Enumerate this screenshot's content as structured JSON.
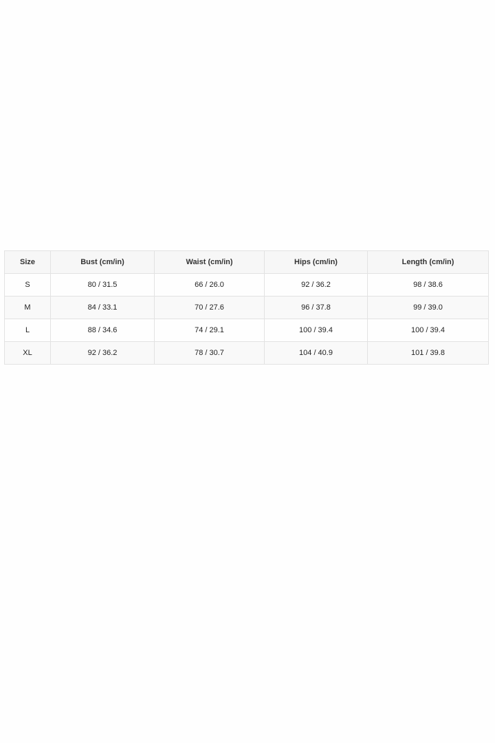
{
  "size_chart": {
    "headers": [
      "Size",
      "Bust (cm/in)",
      "Waist (cm/in)",
      "Hips (cm/in)",
      "Length (cm/in)"
    ],
    "rows": [
      [
        "S",
        "80 / 31.5",
        "66 / 26.0",
        "92 / 36.2",
        "98 / 38.6"
      ],
      [
        "M",
        "84 / 33.1",
        "70 / 27.6",
        "96 / 37.8",
        "99 / 39.0"
      ],
      [
        "L",
        "88 / 34.6",
        "74 / 29.1",
        "100 / 39.4",
        "100 / 39.4"
      ],
      [
        "XL",
        "92 / 36.2",
        "78 / 30.7",
        "104 / 40.9",
        "101 / 39.8"
      ]
    ]
  },
  "colors": {
    "background": "#fefefe",
    "border": "#e2e2e2",
    "header_bg": "#f7f7f7",
    "stripe_bg": "#f9f9f9",
    "text": "#222222"
  }
}
